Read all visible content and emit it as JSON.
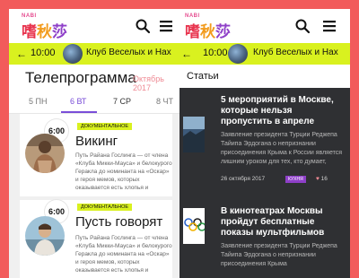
{
  "logo": {
    "small": "NABI",
    "chars": [
      "嗜",
      "秋",
      "莎"
    ]
  },
  "now_playing": {
    "time": "10:00",
    "title": "Клуб Веселых и Нах"
  },
  "tv": {
    "title": "Телепрограмма",
    "month": "Октябрь 2017",
    "days": [
      {
        "label": "5 ПН"
      },
      {
        "label": "6 ВТ"
      },
      {
        "label": "7 СР"
      },
      {
        "label": "8 ЧТ"
      }
    ],
    "shows": [
      {
        "time": "6:00",
        "tag": "ДОКУМЕНТАЛЬНОЕ",
        "name": "Викинг",
        "description": "Путь Райана Гослинга — от члена «Клуба Микки-Мауса» и белокурого Геракла до номинанта на «Оскар» и героя мемов, которых оказывается есть хлопья и"
      },
      {
        "time": "6:00",
        "tag": "ДОКУМЕНТАЛЬНОЕ",
        "name": "Пусть говорят",
        "description": "Путь Райана Гослинга — от члена «Клуба Микки-Мауса» и белокурого Геракла до номинанта на «Оскар» и героя мемов, которых оказывается есть хлопья и"
      }
    ]
  },
  "articles": {
    "title": "Статьи",
    "items": [
      {
        "headline": "5 мероприятий в Москве, которые нельзя пропустить в апреле",
        "text": "Заявление президента Турции Реджепа Тайипа Эрдогана о непризнании присоединения Крыма к России является лишним уроком для тех, кто думает,",
        "date": "26 октября 2017",
        "label": "КУХНЯ",
        "likes": "16"
      },
      {
        "headline": "В кинотеатрах Москвы пройдут бесплатные показы мультфильмов",
        "text": "Заявление президента Турции Реджепа Тайипа Эрдогана о непризнании присоединения Крыма"
      }
    ]
  }
}
